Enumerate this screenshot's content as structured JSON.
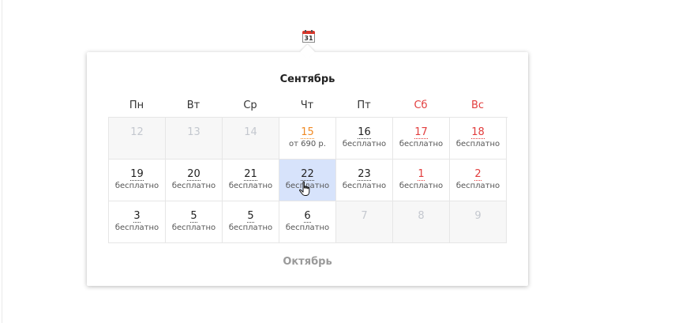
{
  "calendar_icon_day": "31",
  "popup": {
    "month_title": "Сентябрь",
    "weekdays": [
      "Пн",
      "Вт",
      "Ср",
      "Чт",
      "Пт",
      "Сб",
      "Вс"
    ],
    "rows": [
      [
        {
          "day": "12",
          "price": "",
          "state": "disabled"
        },
        {
          "day": "13",
          "price": "",
          "state": "disabled"
        },
        {
          "day": "14",
          "price": "",
          "state": "disabled"
        },
        {
          "day": "15",
          "price": "от 690 р.",
          "state": "paid"
        },
        {
          "day": "16",
          "price": "бесплатно",
          "state": "normal"
        },
        {
          "day": "17",
          "price": "бесплатно",
          "state": "weekend"
        },
        {
          "day": "18",
          "price": "бесплатно",
          "state": "weekend"
        }
      ],
      [
        {
          "day": "19",
          "price": "бесплатно",
          "state": "normal"
        },
        {
          "day": "20",
          "price": "бесплатно",
          "state": "normal"
        },
        {
          "day": "21",
          "price": "бесплатно",
          "state": "normal"
        },
        {
          "day": "22",
          "price": "бесплатно",
          "state": "selected"
        },
        {
          "day": "23",
          "price": "бесплатно",
          "state": "normal"
        },
        {
          "day": "1",
          "price": "бесплатно",
          "state": "weekend"
        },
        {
          "day": "2",
          "price": "бесплатно",
          "state": "weekend"
        }
      ],
      [
        {
          "day": "3",
          "price": "бесплатно",
          "state": "normal"
        },
        {
          "day": "5",
          "price": "бесплатно",
          "state": "normal"
        },
        {
          "day": "5",
          "price": "бесплатно",
          "state": "normal"
        },
        {
          "day": "6",
          "price": "бесплатно",
          "state": "normal"
        },
        {
          "day": "7",
          "price": "",
          "state": "disabled"
        },
        {
          "day": "8",
          "price": "",
          "state": "disabled"
        },
        {
          "day": "9",
          "price": "",
          "state": "disabled"
        }
      ]
    ],
    "next_month": "Октябрь"
  },
  "colors": {
    "weekend": "#e23d3d",
    "paid": "#f08a24",
    "selected_bg": "#d7e3fb",
    "disabled_bg": "#f7f7f7"
  }
}
